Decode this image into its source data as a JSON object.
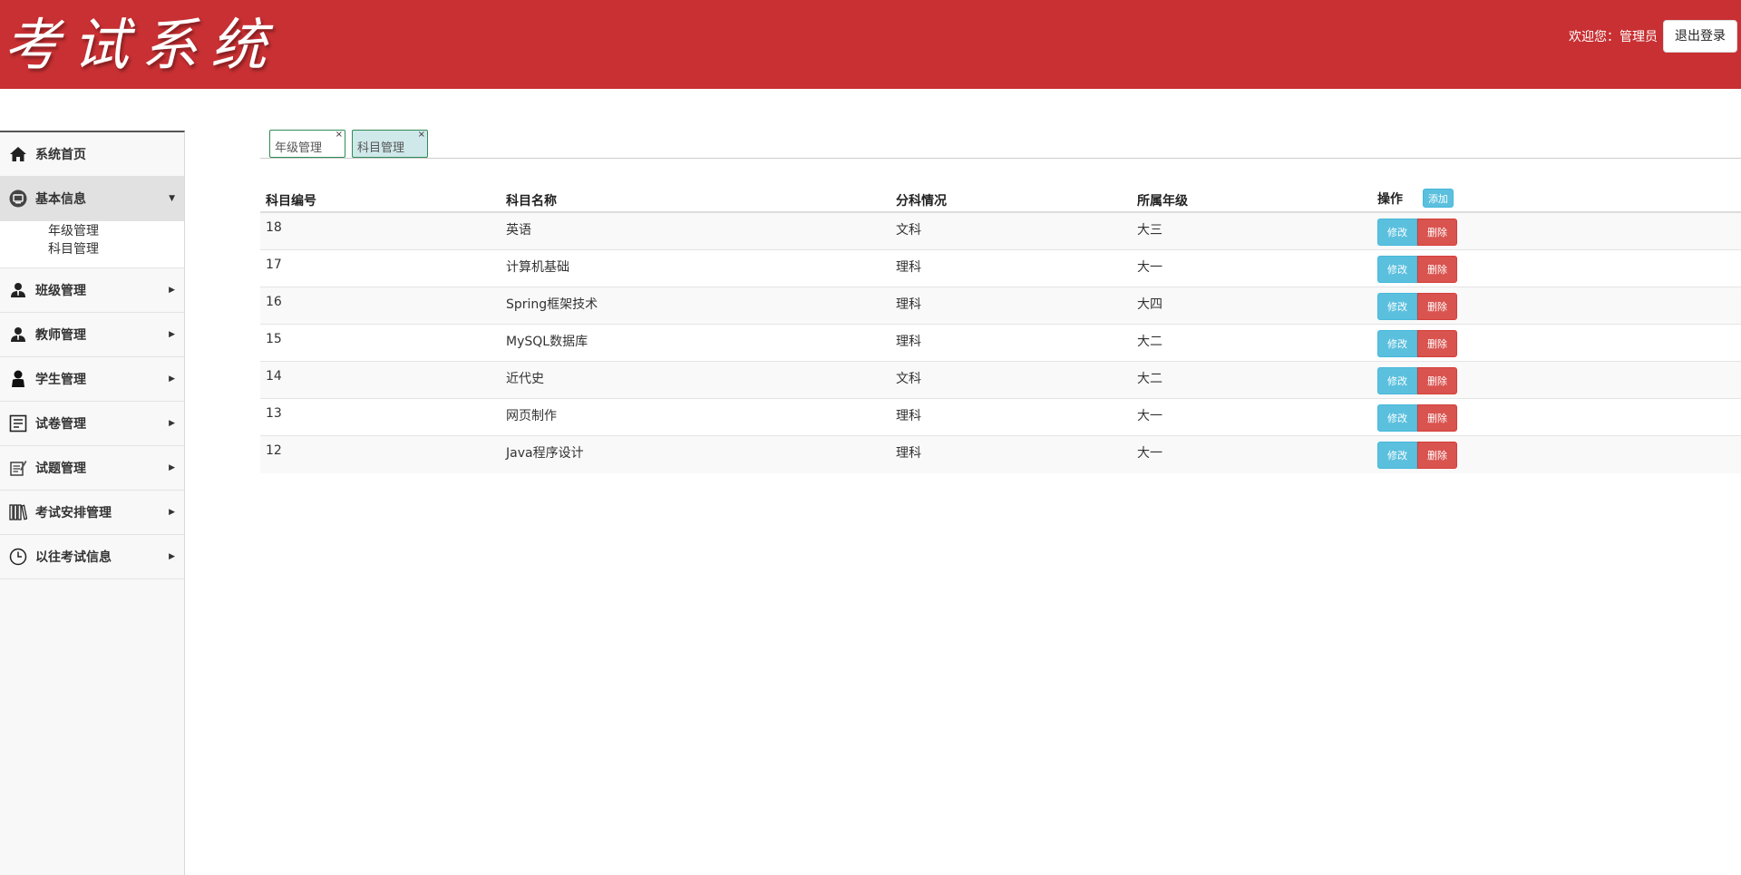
{
  "header": {
    "logo": "考试系统",
    "welcome": "欢迎您：管理员",
    "logout_label": "退出登录"
  },
  "sidebar": {
    "items": [
      {
        "label": "系统首页",
        "icon": "home-icon"
      },
      {
        "label": "基本信息",
        "icon": "desktop-icon",
        "expanded": true,
        "children": [
          {
            "label": "年级管理"
          },
          {
            "label": "科目管理"
          }
        ]
      },
      {
        "label": "班级管理",
        "icon": "user-tie-icon"
      },
      {
        "label": "教师管理",
        "icon": "user-tie-icon"
      },
      {
        "label": "学生管理",
        "icon": "user-icon"
      },
      {
        "label": "试卷管理",
        "icon": "document-icon"
      },
      {
        "label": "试题管理",
        "icon": "edit-document-icon"
      },
      {
        "label": "考试安排管理",
        "icon": "books-icon"
      },
      {
        "label": "以往考试信息",
        "icon": "clock-icon"
      }
    ]
  },
  "tabs": [
    {
      "label": "年级管理",
      "close": "×",
      "active": false
    },
    {
      "label": "科目管理",
      "close": "×",
      "active": true
    }
  ],
  "table": {
    "headers": [
      "科目编号",
      "科目名称",
      "分科情况",
      "所属年级",
      "操作"
    ],
    "add_label": "添加",
    "edit_label": "修改",
    "delete_label": "删除",
    "rows": [
      {
        "id": "18",
        "name": "英语",
        "type": "文科",
        "grade": "大三"
      },
      {
        "id": "17",
        "name": "计算机基础",
        "type": "理科",
        "grade": "大一"
      },
      {
        "id": "16",
        "name": "Spring框架技术",
        "type": "理科",
        "grade": "大四"
      },
      {
        "id": "15",
        "name": "MySQL数据库",
        "type": "理科",
        "grade": "大二"
      },
      {
        "id": "14",
        "name": "近代史",
        "type": "文科",
        "grade": "大二"
      },
      {
        "id": "13",
        "name": "网页制作",
        "type": "理科",
        "grade": "大一"
      },
      {
        "id": "12",
        "name": "Java程序设计",
        "type": "理科",
        "grade": "大一"
      }
    ]
  },
  "colors": {
    "header_bg": "#c83033",
    "btn_info": "#5bc0de",
    "btn_danger": "#d9534f"
  }
}
